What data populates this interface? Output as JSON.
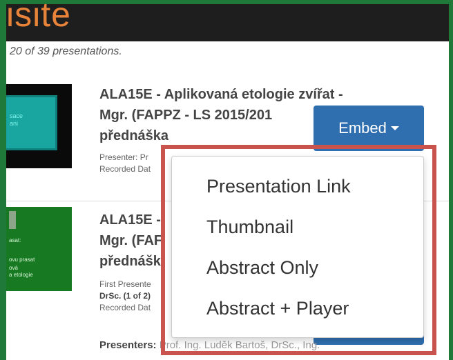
{
  "header": {
    "logo_text": "isite",
    "logo_color": "#e8833a"
  },
  "results_text": "20 of 39 presentations.",
  "items": [
    {
      "title_lines": [
        "ALA15E - Aplikovaná etologie zvířat -",
        "Mgr. (FAPPZ - LS 2015/201",
        "přednáška"
      ],
      "meta_lines": [
        "Presenter: Pr",
        "Recorded Dat"
      ],
      "thumb_text": "sace\nani"
    },
    {
      "title_lines": [
        "ALA15E -",
        "Mgr. (FAF",
        "přednášk"
      ],
      "meta_lines": [
        "First Presente",
        "DrSc. (1 of 2)",
        "Recorded Dat"
      ],
      "thumb_text_1": "asat:",
      "thumb_text_2": "ovu prasat",
      "thumb_text_3": "ová\na etologie"
    }
  ],
  "embed_button": {
    "label": "Embed",
    "color": "#2f6fb0"
  },
  "embed_menu": {
    "items": [
      "Presentation Link",
      "Thumbnail",
      "Abstract Only",
      "Abstract + Player"
    ]
  },
  "presenters": {
    "label": "Presenters:",
    "value": "Prof. Ing. Luděk Bartoš, DrSc., Ing."
  },
  "highlight_color": "#c9534d"
}
